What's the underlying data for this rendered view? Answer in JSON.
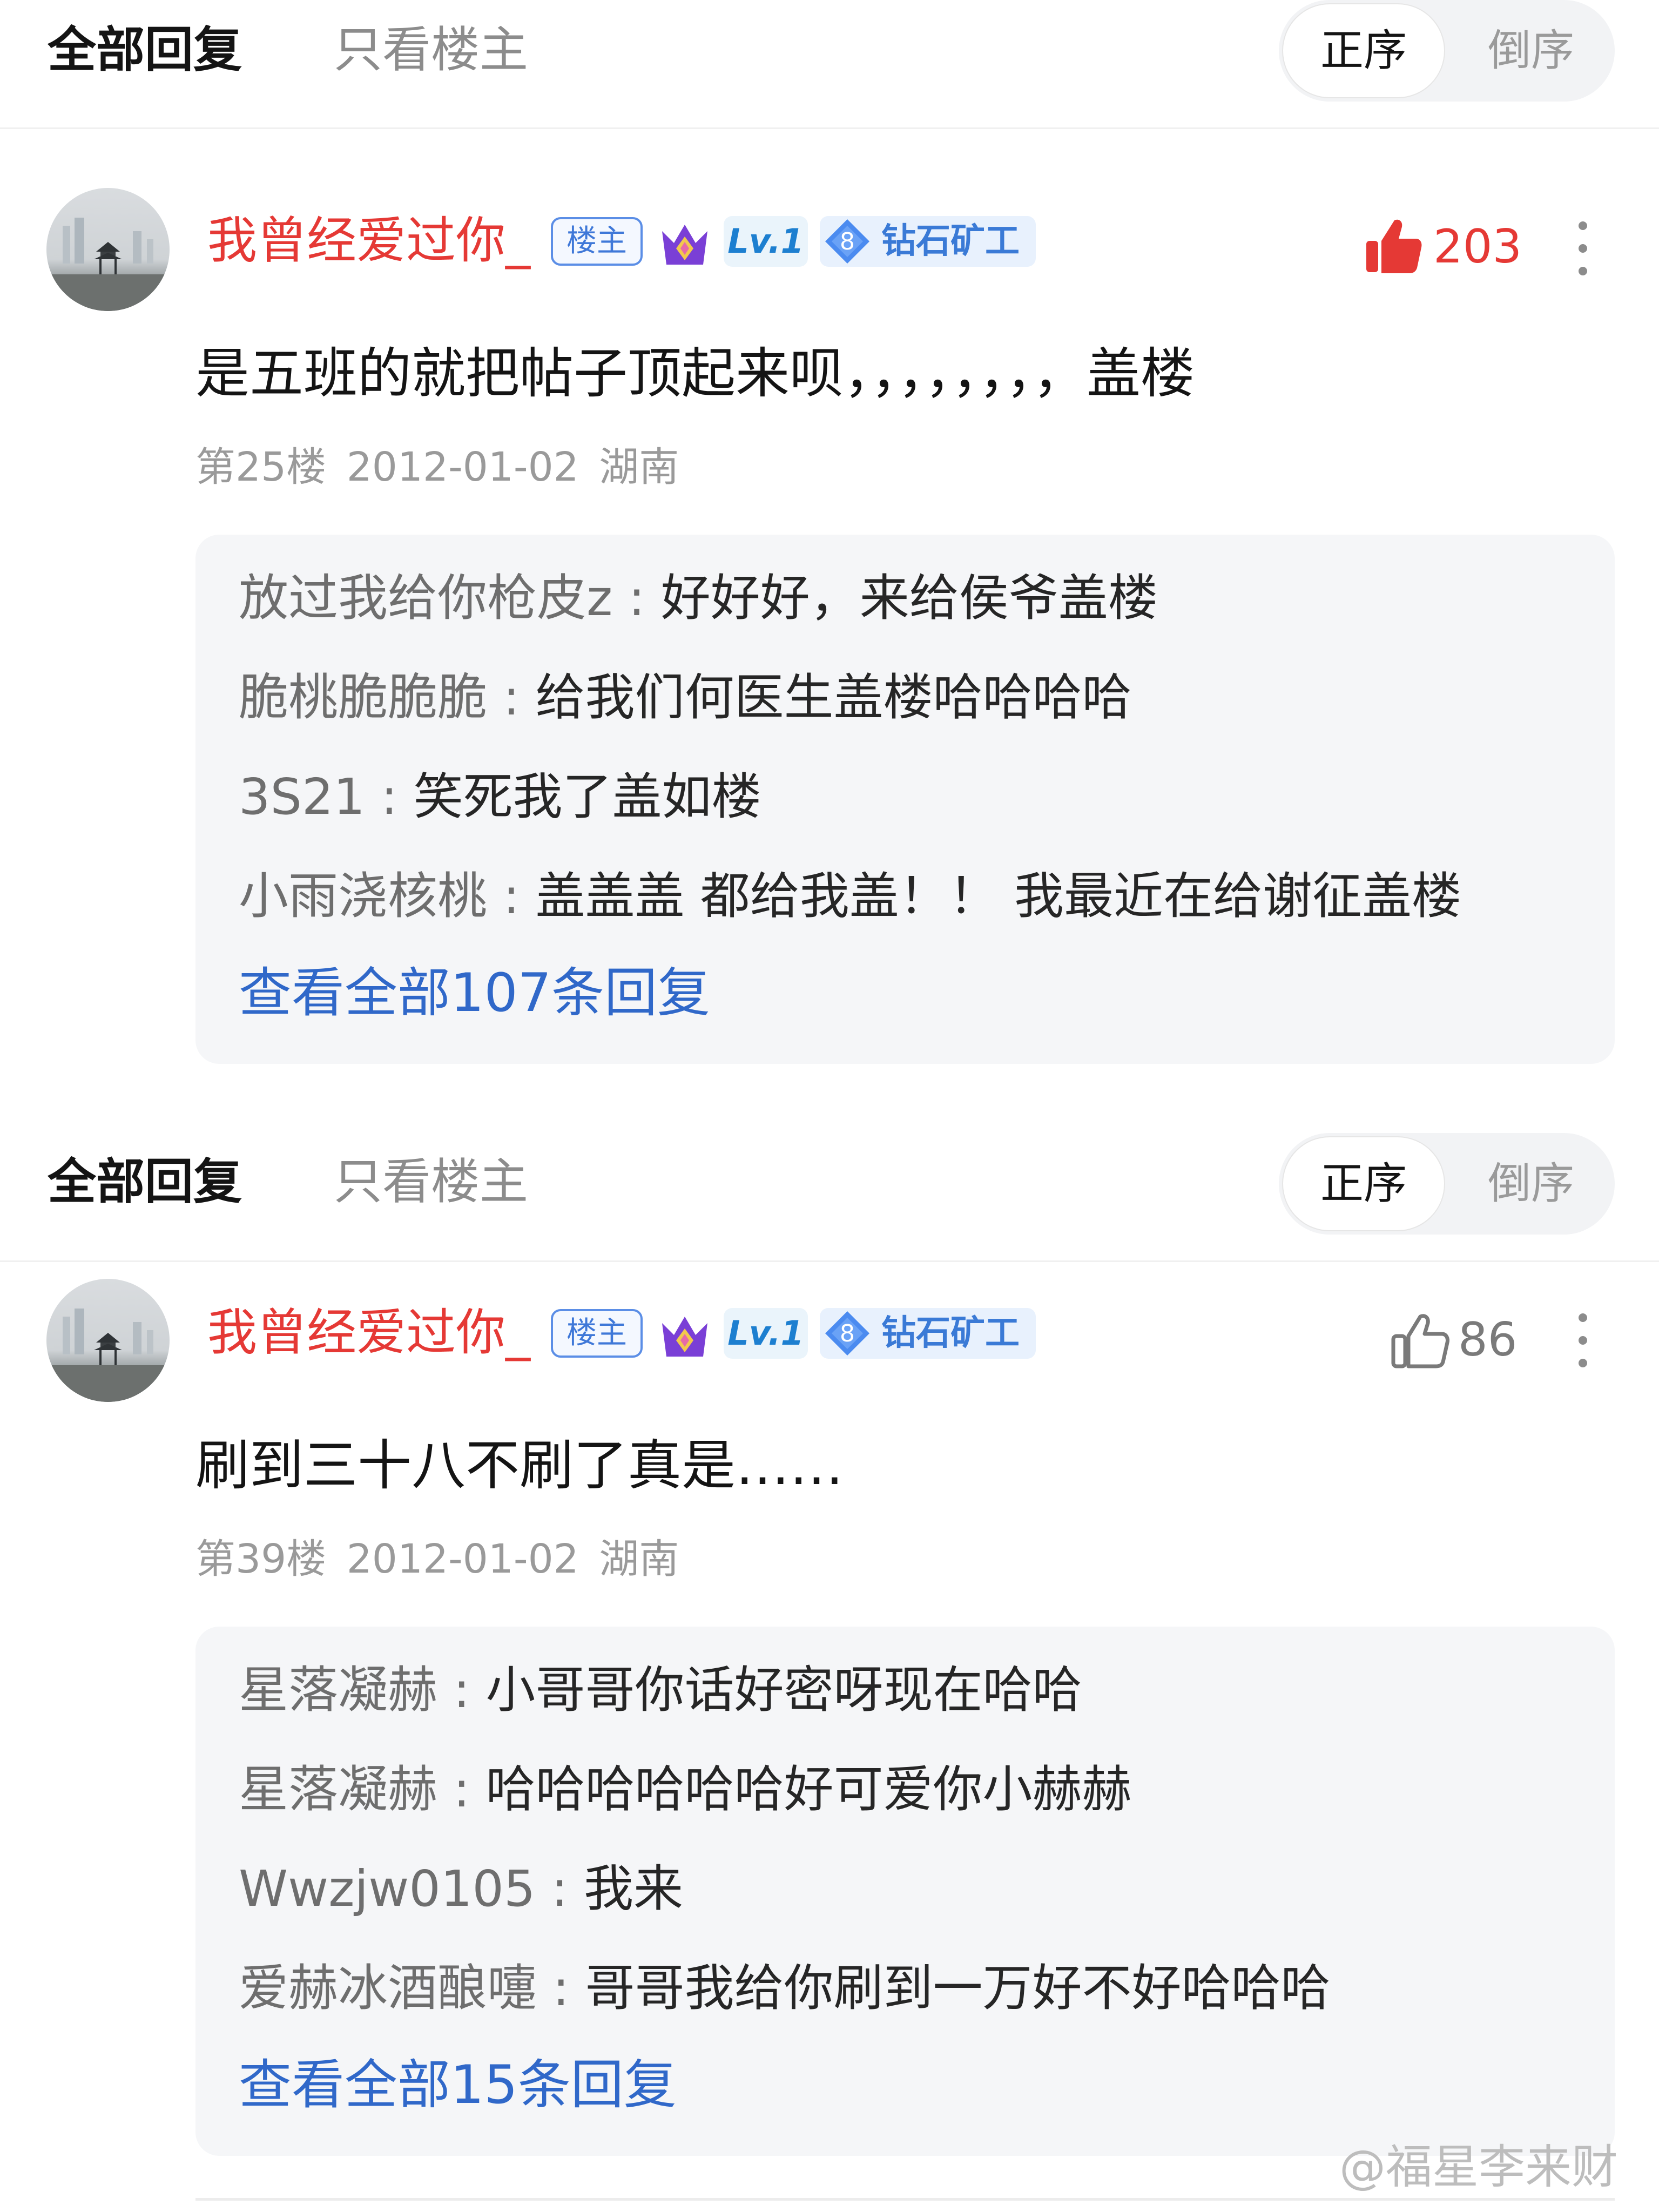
{
  "tabs": {
    "all_replies": "全部回复",
    "op_only": "只看楼主",
    "order_asc": "正序",
    "order_desc": "倒序"
  },
  "badges": {
    "op": "楼主",
    "level": "Lv.1",
    "miner_rank": "8",
    "miner_label": "钻石矿工"
  },
  "posts": [
    {
      "username": "我曾经爱过你_",
      "likes": "203",
      "liked": true,
      "content": "是五班的就把帖子顶起来呗，，，，，，，，盖楼",
      "floor": "第25楼",
      "date": "2012-01-02",
      "location": "湖南",
      "replies": [
        {
          "name": "放过我给你枪皮z",
          "text": "好好好，来给侯爷盖楼"
        },
        {
          "name": "脆桃脆脆脆",
          "text": "给我们何医生盖楼哈哈哈哈"
        },
        {
          "name": "3S21",
          "text": "笑死我了盖如楼"
        },
        {
          "name": "小雨浇核桃",
          "text": "盖盖盖 都给我盖！！ 我最近在给谢征盖楼"
        }
      ],
      "view_all": "查看全部107条回复"
    },
    {
      "username": "我曾经爱过你_",
      "likes": "86",
      "liked": false,
      "content": "刷到三十八不刷了真是……",
      "floor": "第39楼",
      "date": "2012-01-02",
      "location": "湖南",
      "replies": [
        {
          "name": "星落凝赫",
          "text": "小哥哥你话好密呀现在哈哈"
        },
        {
          "name": "星落凝赫",
          "text": "哈哈哈哈哈哈好可爱你小赫赫"
        },
        {
          "name": "Wwzjw0105",
          "text": "我来"
        },
        {
          "name": "爱赫冰酒酿嚏",
          "text": "哥哥我给你刷到一万好不好哈哈哈"
        }
      ],
      "view_all": "查看全部15条回复"
    }
  ],
  "reply_separator": " : ",
  "watermark": "@福星李来财",
  "colors": {
    "username": "#e53935",
    "like_active": "#e53935",
    "link": "#3068c9",
    "meta": "#9a9a9a"
  }
}
